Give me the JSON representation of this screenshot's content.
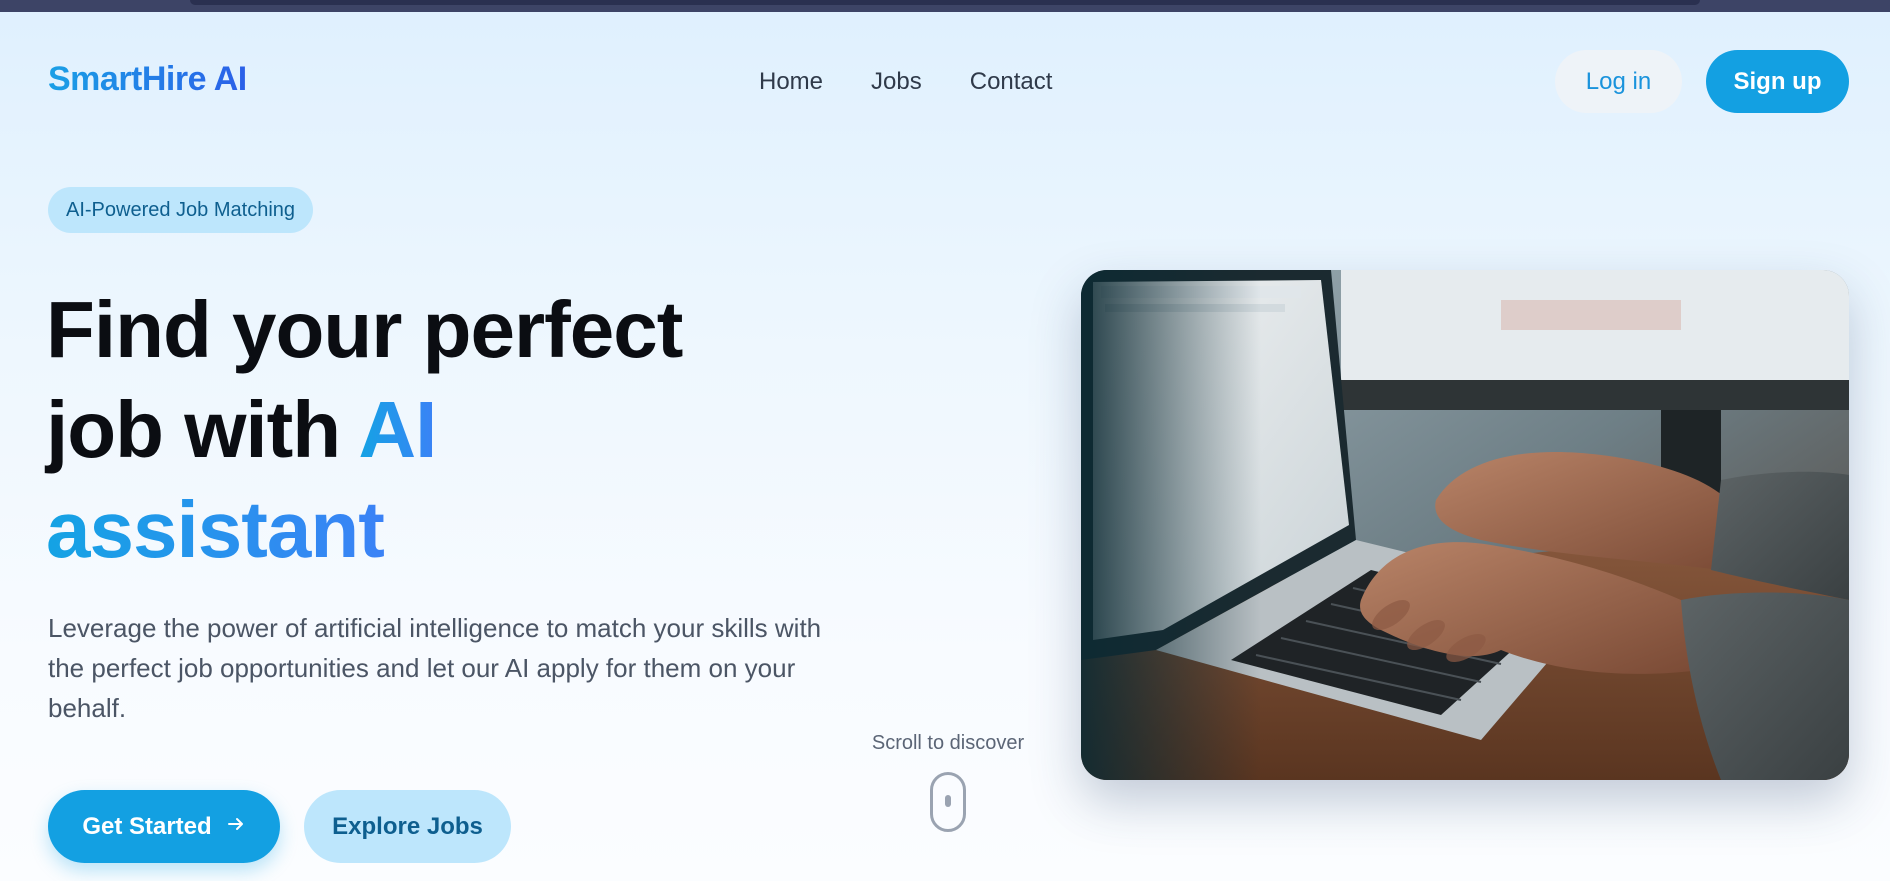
{
  "header": {
    "logo": "SmartHire AI",
    "nav": [
      {
        "label": "Home"
      },
      {
        "label": "Jobs"
      },
      {
        "label": "Contact"
      }
    ],
    "login_label": "Log in",
    "signup_label": "Sign up"
  },
  "hero": {
    "badge": "AI-Powered Job Matching",
    "title_line1": "Find your perfect",
    "title_line2_plain": "job with ",
    "title_line2_accent": "AI",
    "title_line3_accent": "assistant",
    "description": "Leverage the power of artificial intelligence to match your skills with the perfect job opportunities and let our AI apply for them on your behalf.",
    "primary_cta": "Get Started",
    "primary_cta_icon": "arrow-right-icon",
    "secondary_cta": "Explore Jobs",
    "scroll_hint": "Scroll to discover",
    "scroll_icon": "mouse-icon",
    "image_subject": "hands-typing-on-laptop"
  },
  "colors": {
    "brand_blue": "#13a0e2",
    "brand_blue_dark": "#2b5fe8",
    "badge_bg": "#bde6fc",
    "badge_text": "#0e5f8f",
    "title_text": "#0b0d12",
    "body_text": "#4b5565"
  }
}
